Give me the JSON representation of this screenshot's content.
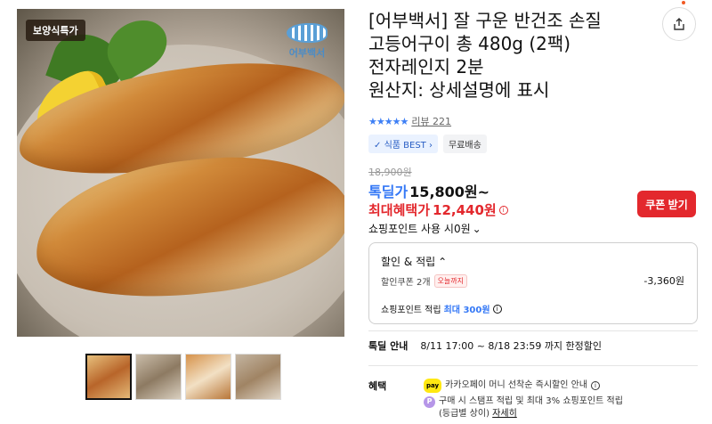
{
  "gallery": {
    "badge": "보양식특가",
    "brand_logo_text": "어부백서",
    "thumbnails": 4
  },
  "product": {
    "title_lines": [
      "[어부백서] 잘 구운 반건조 손질",
      "고등어구이 총 480g (2팩)",
      "전자레인지 2분",
      "원산지: 상세설명에 표시"
    ],
    "stars": "★★★★★",
    "review_label": "리뷰 221",
    "tags": [
      "식품 BEST",
      "무료배송"
    ],
    "original_price": "18,900원",
    "deal_label": "톡딜가",
    "deal_price": "15,800원~",
    "max_benefit_label": "최대혜택가",
    "max_benefit_price": "12,440원",
    "coupon_button": "쿠폰 받기",
    "point_use": "쇼핑포인트 사용 시0원"
  },
  "benefit_box": {
    "heading": "할인 & 적립",
    "coupon_label": "할인쿠폰 2개",
    "today_tag": "오늘까지",
    "coupon_amount": "-3,360원",
    "point_prefix": "쇼핑포인트 적립",
    "point_max": "최대 300원"
  },
  "deal_guide": {
    "label": "톡딜 안내",
    "text": "8/11 17:00 ~ 8/18 23:59 까지 한정할인"
  },
  "benefits": {
    "label": "혜택",
    "kakao_badge": "pay",
    "kakao_text": "카카오페이 머니 선착순 즉시할인 안내",
    "p_icon": "P",
    "stamp_text": "구매 시 스탬프 적립 및 최대 3% 쇼핑포인트 적립",
    "stamp_sub": "(등급별 상이)",
    "detail_link": "자세히"
  }
}
